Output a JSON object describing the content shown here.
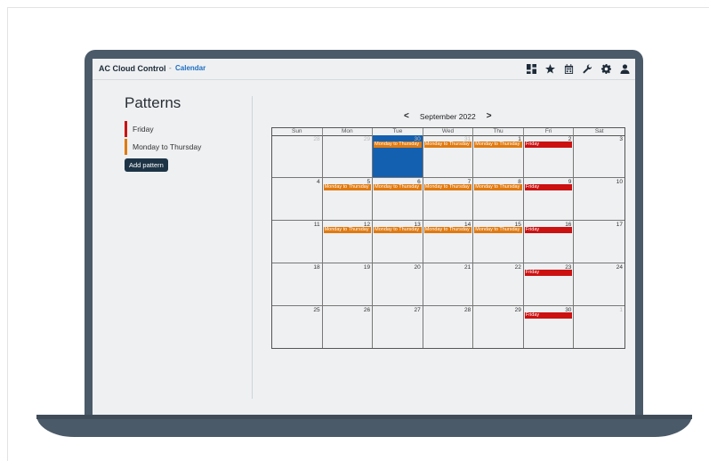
{
  "app": {
    "name": "AC Cloud Control",
    "separator": "-",
    "section": "Calendar",
    "icons": [
      "dashboard-icon",
      "star-icon",
      "calendar-icon",
      "wrench-icon",
      "gear-icon",
      "user-icon"
    ]
  },
  "sidebar": {
    "title": "Patterns",
    "patterns": [
      {
        "label": "Friday",
        "color": "#cc1111"
      },
      {
        "label": "Monday to Thursday",
        "color": "#e07a10"
      }
    ],
    "add_button": "Add pattern"
  },
  "calendar": {
    "prev": "<",
    "next": ">",
    "month": "September 2022",
    "weekdays": [
      "Sun",
      "Mon",
      "Tue",
      "Wed",
      "Thu",
      "Fri",
      "Sat"
    ],
    "colors": {
      "friday": "#cc1111",
      "mon_thu": "#e07a10",
      "today": "#1460b0"
    },
    "weeks": [
      [
        {
          "day": "28",
          "other": true
        },
        {
          "day": "29",
          "other": true
        },
        {
          "day": "30",
          "other": true,
          "today": true,
          "event": "Monday to Thursday",
          "type": "mon_thu"
        },
        {
          "day": "31",
          "other": true,
          "event": "Monday to Thursday",
          "type": "mon_thu"
        },
        {
          "day": "1",
          "event": "Monday to Thursday",
          "type": "mon_thu"
        },
        {
          "day": "2",
          "event": "Friday",
          "type": "friday"
        },
        {
          "day": "3"
        }
      ],
      [
        {
          "day": "4"
        },
        {
          "day": "5",
          "event": "Monday to Thursday",
          "type": "mon_thu"
        },
        {
          "day": "6",
          "event": "Monday to Thursday",
          "type": "mon_thu"
        },
        {
          "day": "7",
          "event": "Monday to Thursday",
          "type": "mon_thu"
        },
        {
          "day": "8",
          "event": "Monday to Thursday",
          "type": "mon_thu"
        },
        {
          "day": "9",
          "event": "Friday",
          "type": "friday"
        },
        {
          "day": "10"
        }
      ],
      [
        {
          "day": "11"
        },
        {
          "day": "12",
          "event": "Monday to Thursday",
          "type": "mon_thu"
        },
        {
          "day": "13",
          "event": "Monday to Thursday",
          "type": "mon_thu"
        },
        {
          "day": "14",
          "event": "Monday to Thursday",
          "type": "mon_thu"
        },
        {
          "day": "15",
          "event": "Monday to Thursday",
          "type": "mon_thu"
        },
        {
          "day": "16",
          "event": "Friday",
          "type": "friday"
        },
        {
          "day": "17"
        }
      ],
      [
        {
          "day": "18"
        },
        {
          "day": "19"
        },
        {
          "day": "20"
        },
        {
          "day": "21"
        },
        {
          "day": "22"
        },
        {
          "day": "23",
          "event": "Friday",
          "type": "friday"
        },
        {
          "day": "24"
        }
      ],
      [
        {
          "day": "25"
        },
        {
          "day": "26"
        },
        {
          "day": "27"
        },
        {
          "day": "28"
        },
        {
          "day": "29"
        },
        {
          "day": "30",
          "event": "Friday",
          "type": "friday"
        },
        {
          "day": "1",
          "other": true
        }
      ]
    ]
  }
}
